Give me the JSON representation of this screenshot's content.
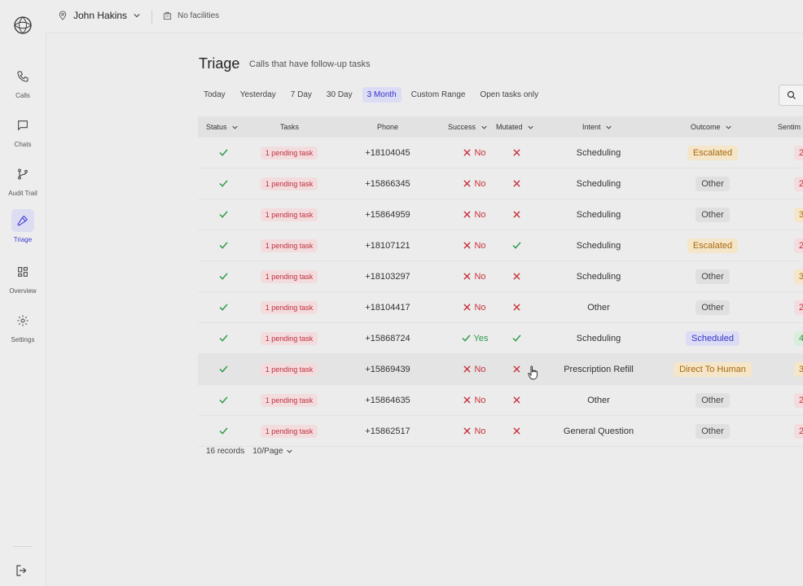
{
  "header": {
    "user_name": "John Hakins",
    "facility": "No facilities"
  },
  "sidebar": {
    "items": [
      {
        "label": "Calls",
        "icon": "phone-icon"
      },
      {
        "label": "Chats",
        "icon": "chat-icon"
      },
      {
        "label": "Audit Trail",
        "icon": "branch-icon"
      },
      {
        "label": "Triage",
        "icon": "hammer-icon",
        "active": true
      },
      {
        "label": "Overview",
        "icon": "grid-icon"
      },
      {
        "label": "Settings",
        "icon": "gear-icon"
      }
    ]
  },
  "page": {
    "title": "Triage",
    "subtitle": "Calls that have follow-up tasks"
  },
  "filters": [
    "Today",
    "Yesterday",
    "7 Day",
    "30 Day",
    "3 Month",
    "Custom Range",
    "Open tasks only"
  ],
  "active_filter": "3 Month",
  "table": {
    "columns": [
      "Status",
      "Tasks",
      "Phone",
      "Success",
      "Mutated",
      "Intent",
      "Outcome",
      "Sentim"
    ],
    "rows": [
      {
        "tasks": "1 pending task",
        "phone": "+18104045",
        "success": "No",
        "mutated": false,
        "intent": "Scheduling",
        "outcome": "Escalated",
        "senti": "2"
      },
      {
        "tasks": "1 pending task",
        "phone": "+15866345",
        "success": "No",
        "mutated": false,
        "intent": "Scheduling",
        "outcome": "Other",
        "senti": "2"
      },
      {
        "tasks": "1 pending task",
        "phone": "+15864959",
        "success": "No",
        "mutated": false,
        "intent": "Scheduling",
        "outcome": "Other",
        "senti": "3"
      },
      {
        "tasks": "1 pending task",
        "phone": "+18107121",
        "success": "No",
        "mutated": true,
        "intent": "Scheduling",
        "outcome": "Escalated",
        "senti": "2"
      },
      {
        "tasks": "1 pending task",
        "phone": "+18103297",
        "success": "No",
        "mutated": false,
        "intent": "Scheduling",
        "outcome": "Other",
        "senti": "3"
      },
      {
        "tasks": "1 pending task",
        "phone": "+18104417",
        "success": "No",
        "mutated": false,
        "intent": "Other",
        "outcome": "Other",
        "senti": "2"
      },
      {
        "tasks": "1 pending task",
        "phone": "+15868724",
        "success": "Yes",
        "mutated": true,
        "intent": "Scheduling",
        "outcome": "Scheduled",
        "senti": "4"
      },
      {
        "tasks": "1 pending task",
        "phone": "+15869439",
        "success": "No",
        "mutated": false,
        "intent": "Prescription Refill",
        "outcome": "Direct To Human",
        "senti": "3"
      },
      {
        "tasks": "1 pending task",
        "phone": "+15864635",
        "success": "No",
        "mutated": false,
        "intent": "Other",
        "outcome": "Other",
        "senti": "2"
      },
      {
        "tasks": "1 pending task",
        "phone": "+15862517",
        "success": "No",
        "mutated": false,
        "intent": "General Question",
        "outcome": "Other",
        "senti": "2"
      }
    ]
  },
  "footer": {
    "records": "16 records",
    "page_size": "10/Page"
  },
  "colors": {
    "accent": "#3535c8",
    "success": "#2f9a4a",
    "danger": "#c8323c",
    "escalated_bg": "#f5e6c9",
    "escalated_fg": "#a8680f",
    "scheduled_bg": "#dcdcf5",
    "scheduled_fg": "#3535c8",
    "other_bg": "#e0e0e0",
    "other_fg": "#444444"
  }
}
